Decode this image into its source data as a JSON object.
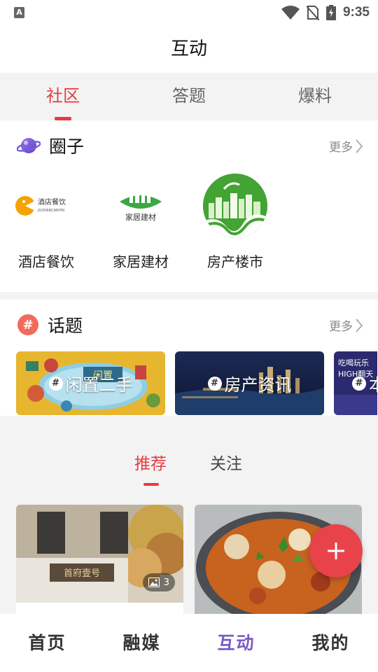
{
  "status_bar": {
    "time": "9:35",
    "left_icon_letter": "A"
  },
  "header": {
    "title": "互动"
  },
  "top_tabs": [
    {
      "label": "社区",
      "active": true
    },
    {
      "label": "答题",
      "active": false
    },
    {
      "label": "爆料",
      "active": false
    }
  ],
  "quanzi": {
    "title": "圈子",
    "more_label": "更多",
    "items": [
      {
        "name": "酒店餐饮",
        "logo_text": "酒店餐饮",
        "logo_subtext": "JIUDIANCANYIN"
      },
      {
        "name": "家居建材",
        "logo_text": "家居建材"
      },
      {
        "name": "房产楼市"
      }
    ]
  },
  "huati": {
    "title": "话题",
    "more_label": "更多",
    "topics": [
      {
        "label": "闲置二手",
        "sign_text": "闲置"
      },
      {
        "label": "房产资讯"
      },
      {
        "label": "本",
        "bg_text": "吃喝玩乐 HIGH翻天"
      }
    ]
  },
  "feed_tabs": [
    {
      "label": "推荐",
      "active": true
    },
    {
      "label": "关注",
      "active": false
    }
  ],
  "feed": {
    "cards": [
      {
        "image_count": "3",
        "sign_text": "首府壹号"
      },
      {
        "image_count": ""
      }
    ]
  },
  "fab": {
    "icon": "plus-icon"
  },
  "bottom_nav": [
    {
      "label": "首页",
      "active": false
    },
    {
      "label": "融媒",
      "active": false
    },
    {
      "label": "互动",
      "active": true
    },
    {
      "label": "我的",
      "active": false
    }
  ],
  "colors": {
    "accent": "#e83a3f",
    "active_nav": "#7b5bc9",
    "fab": "#e8424a"
  }
}
